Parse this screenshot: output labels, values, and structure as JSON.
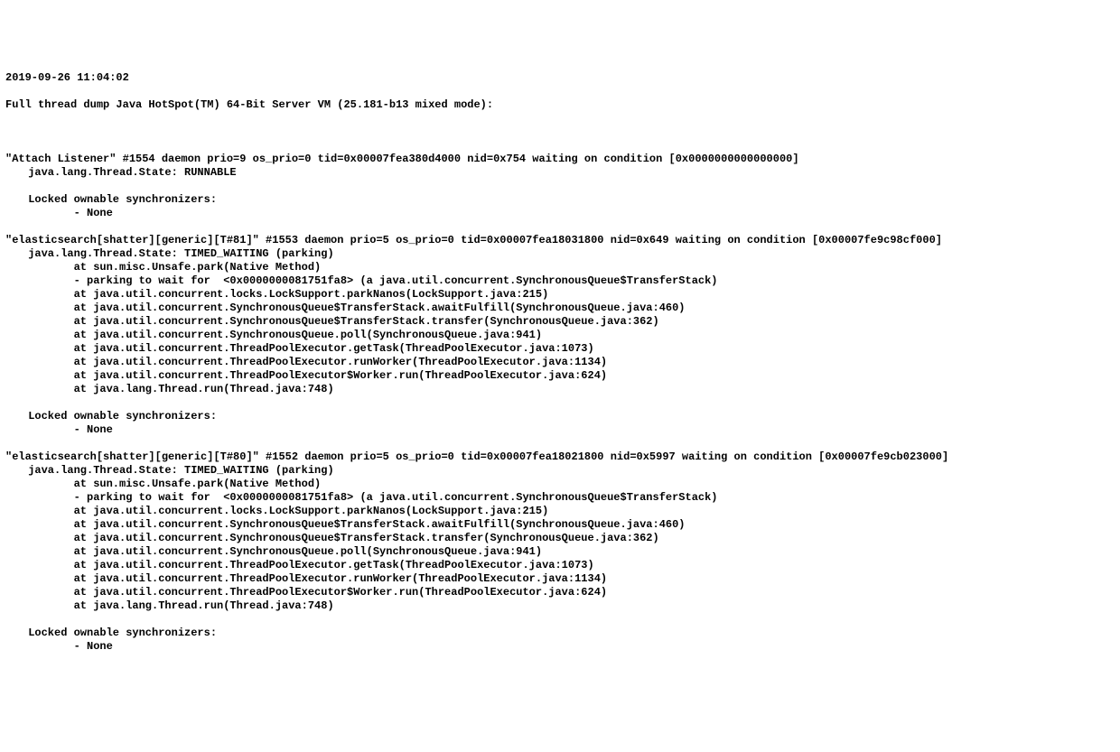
{
  "timestamp": "2019-09-26 11:04:02",
  "header": "Full thread dump Java HotSpot(TM) 64-Bit Server VM (25.181-b13 mixed mode):",
  "threads": [
    {
      "name_line": "\"Attach Listener\" #1554 daemon prio=9 os_prio=0 tid=0x00007fea380d4000 nid=0x754 waiting on condition [0x0000000000000000]",
      "state_line": "java.lang.Thread.State: RUNNABLE",
      "stack": [],
      "sync_header": "Locked ownable synchronizers:",
      "sync_items": [
        "- None"
      ]
    },
    {
      "name_line": "\"elasticsearch[shatter][generic][T#81]\" #1553 daemon prio=5 os_prio=0 tid=0x00007fea18031800 nid=0x649 waiting on condition [0x00007fe9c98cf000]",
      "state_line": "java.lang.Thread.State: TIMED_WAITING (parking)",
      "stack": [
        "at sun.misc.Unsafe.park(Native Method)",
        "- parking to wait for  <0x0000000081751fa8> (a java.util.concurrent.SynchronousQueue$TransferStack)",
        "at java.util.concurrent.locks.LockSupport.parkNanos(LockSupport.java:215)",
        "at java.util.concurrent.SynchronousQueue$TransferStack.awaitFulfill(SynchronousQueue.java:460)",
        "at java.util.concurrent.SynchronousQueue$TransferStack.transfer(SynchronousQueue.java:362)",
        "at java.util.concurrent.SynchronousQueue.poll(SynchronousQueue.java:941)",
        "at java.util.concurrent.ThreadPoolExecutor.getTask(ThreadPoolExecutor.java:1073)",
        "at java.util.concurrent.ThreadPoolExecutor.runWorker(ThreadPoolExecutor.java:1134)",
        "at java.util.concurrent.ThreadPoolExecutor$Worker.run(ThreadPoolExecutor.java:624)",
        "at java.lang.Thread.run(Thread.java:748)"
      ],
      "sync_header": "Locked ownable synchronizers:",
      "sync_items": [
        "- None"
      ]
    },
    {
      "name_line": "\"elasticsearch[shatter][generic][T#80]\" #1552 daemon prio=5 os_prio=0 tid=0x00007fea18021800 nid=0x5997 waiting on condition [0x00007fe9cb023000]",
      "state_line": "java.lang.Thread.State: TIMED_WAITING (parking)",
      "stack": [
        "at sun.misc.Unsafe.park(Native Method)",
        "- parking to wait for  <0x0000000081751fa8> (a java.util.concurrent.SynchronousQueue$TransferStack)",
        "at java.util.concurrent.locks.LockSupport.parkNanos(LockSupport.java:215)",
        "at java.util.concurrent.SynchronousQueue$TransferStack.awaitFulfill(SynchronousQueue.java:460)",
        "at java.util.concurrent.SynchronousQueue$TransferStack.transfer(SynchronousQueue.java:362)",
        "at java.util.concurrent.SynchronousQueue.poll(SynchronousQueue.java:941)",
        "at java.util.concurrent.ThreadPoolExecutor.getTask(ThreadPoolExecutor.java:1073)",
        "at java.util.concurrent.ThreadPoolExecutor.runWorker(ThreadPoolExecutor.java:1134)",
        "at java.util.concurrent.ThreadPoolExecutor$Worker.run(ThreadPoolExecutor.java:624)",
        "at java.lang.Thread.run(Thread.java:748)"
      ],
      "sync_header": "Locked ownable synchronizers:",
      "sync_items": [
        "- None"
      ]
    }
  ]
}
